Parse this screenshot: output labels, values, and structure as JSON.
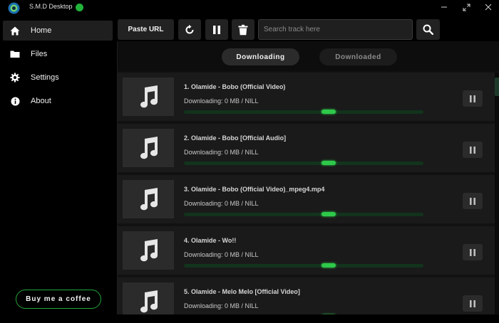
{
  "window": {
    "title": "S.M.D Desktop",
    "icons": {
      "logo": "app-logo-icon",
      "status": "status-dot-icon",
      "minimize": "minimize-icon",
      "maximize": "maximize-icon",
      "close": "close-icon"
    },
    "status_color": "#22b33a"
  },
  "sidebar": {
    "items": [
      {
        "label": "Home",
        "icon": "home-icon",
        "active": true
      },
      {
        "label": "Files",
        "icon": "folder-icon",
        "active": false
      },
      {
        "label": "Settings",
        "icon": "gear-icon",
        "active": false
      },
      {
        "label": "About",
        "icon": "info-icon",
        "active": false
      }
    ],
    "coffee_label": "Buy me a coffee"
  },
  "toolbar": {
    "paste_label": "Paste URL",
    "refresh_icon": "refresh-icon",
    "pause_icon": "pause-icon",
    "delete_icon": "trash-icon",
    "search_placeholder": "Search track here",
    "search_value": "",
    "search_icon": "search-icon"
  },
  "tabs": {
    "downloading": "Downloading",
    "downloaded": "Downloaded",
    "active": "downloading"
  },
  "tracks": [
    {
      "title": "1.  Olamide - Bobo (Official Video)",
      "status": "Downloading: 0 MB / NILL"
    },
    {
      "title": "2.  Olamide - Bobo [Official Audio]",
      "status": "Downloading: 0 MB / NILL"
    },
    {
      "title": "3.  Olamide - Bobo (Official Video)_mpeg4.mp4",
      "status": "Downloading: 0 MB / NILL"
    },
    {
      "title": "4.  Olamide - Wo!!",
      "status": "Downloading: 0 MB / NILL"
    },
    {
      "title": "5.  Olamide - Melo Melo [Official Video]",
      "status": "Downloading: 0 MB / NILL"
    }
  ],
  "colors": {
    "accent": "#2ec94a",
    "background": "#000000",
    "panel": "#1a1a1a"
  }
}
